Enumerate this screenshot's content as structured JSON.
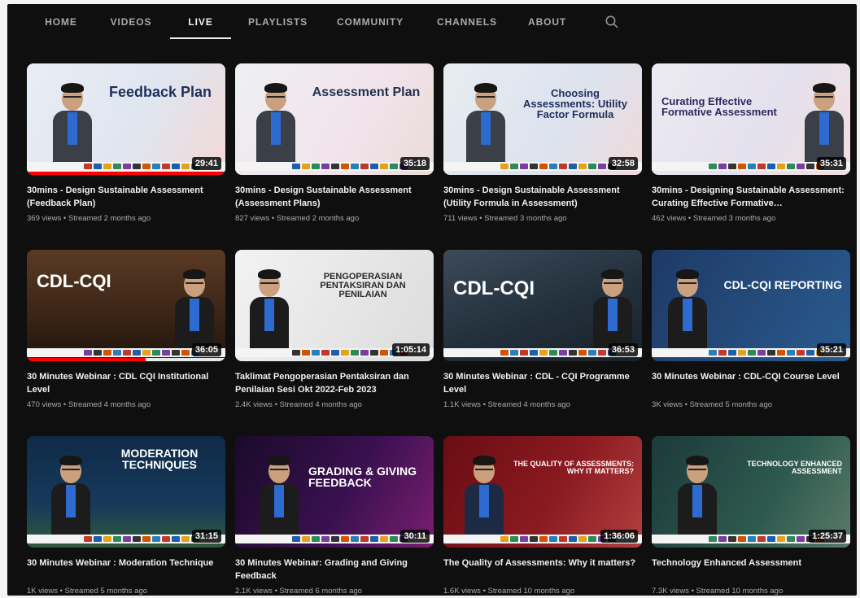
{
  "nav": {
    "tabs": [
      {
        "label": "HOME"
      },
      {
        "label": "VIDEOS"
      },
      {
        "label": "LIVE"
      },
      {
        "label": "PLAYLISTS"
      },
      {
        "label": "COMMUNITY"
      },
      {
        "label": "CHANNELS"
      },
      {
        "label": "ABOUT"
      }
    ],
    "active_tab": "LIVE",
    "search_icon": "search-icon"
  },
  "colors": {
    "background": "#0f0f0f",
    "text_primary": "#f1f1f1",
    "text_secondary": "#aaaaaa",
    "progress": "#ff0000"
  },
  "videos": [
    {
      "title": "30mins - Design Sustainable Assessment (Feedback Plan)",
      "views": "369 views",
      "age": "Streamed 2 months ago",
      "duration": "29:41",
      "thumb_headline": "Feedback Plan",
      "progress": 1.0
    },
    {
      "title": "30mins - Design Sustainable Assessment (Assessment Plans)",
      "views": "827 views",
      "age": "Streamed 2 months ago",
      "duration": "35:18",
      "thumb_headline": "Assessment Plan",
      "progress": 0
    },
    {
      "title": "30mins - Design Sustainable Assessment (Utility Formula in Assessment)",
      "views": "711 views",
      "age": "Streamed 3 months ago",
      "duration": "32:58",
      "thumb_headline": "Choosing Assessments: Utility Factor Formula",
      "progress": 0
    },
    {
      "title": "30mins - Designing Sustainable Assessment: Curating Effective Formative…",
      "views": "462 views",
      "age": "Streamed 3 months ago",
      "duration": "35:31",
      "thumb_headline": "Curating Effective Formative Assessment",
      "progress": 0
    },
    {
      "title": "30 Minutes Webinar : CDL CQI Institutional Level",
      "views": "470 views",
      "age": "Streamed 4 months ago",
      "duration": "36:05",
      "thumb_headline": "CDL-CQI",
      "progress": 0.6
    },
    {
      "title": "Taklimat Pengoperasian Pentaksiran dan Penilaian Sesi Okt 2022-Feb 2023",
      "views": "2.4K views",
      "age": "Streamed 4 months ago",
      "duration": "1:05:14",
      "thumb_headline": "PENGOPERASIAN PENTAKSIRAN DAN PENILAIAN",
      "progress": 0
    },
    {
      "title": "30 Minutes Webinar : CDL - CQI Programme Level",
      "views": "1.1K views",
      "age": "Streamed 4 months ago",
      "duration": "36:53",
      "thumb_headline": "CDL-CQI",
      "progress": 0
    },
    {
      "title": "30 Minutes Webinar : CDL-CQI Course Level",
      "views": "3K views",
      "age": "Streamed 5 months ago",
      "duration": "35:21",
      "thumb_headline": "CDL-CQI REPORTING",
      "progress": 0
    },
    {
      "title": "30 Minutes Webinar : Moderation Technique",
      "views": "1K views",
      "age": "Streamed 5 months ago",
      "duration": "31:15",
      "thumb_headline": "MODERATION TECHNIQUES",
      "progress": 0
    },
    {
      "title": "30 Minutes Webinar: Grading and Giving Feedback",
      "views": "2.1K views",
      "age": "Streamed 6 months ago",
      "duration": "30:11",
      "thumb_headline": "GRADING & GIVING FEEDBACK",
      "progress": 0
    },
    {
      "title": "The Quality of Assessments: Why it matters?",
      "views": "1.6K views",
      "age": "Streamed 10 months ago",
      "duration": "1:36:06",
      "thumb_headline": "THE QUALITY OF ASSESSMENTS: WHY IT MATTERS?",
      "progress": 0
    },
    {
      "title": "Technology Enhanced Assessment",
      "views": "7.3K views",
      "age": "Streamed 10 months ago",
      "duration": "1:25:37",
      "thumb_headline": "TECHNOLOGY ENHANCED ASSESSMENT",
      "progress": 0
    }
  ]
}
